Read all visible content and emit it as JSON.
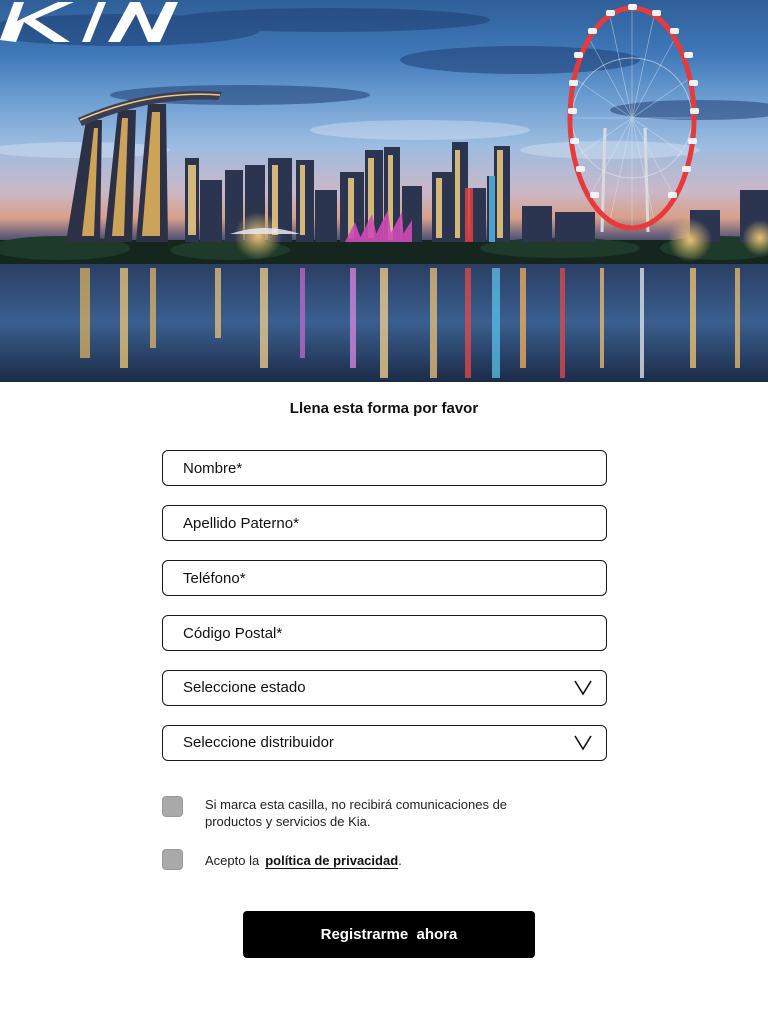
{
  "hero": {
    "image": "singapore-skyline-marina-bay-night",
    "logo_text": "KIA",
    "logo_icon": "kia-logo"
  },
  "form": {
    "title": "Llena esta forma por favor",
    "fields": {
      "nombre": {
        "placeholder": "Nombre*",
        "value": ""
      },
      "apellido": {
        "placeholder": "Apellido Paterno*",
        "value": ""
      },
      "telefono": {
        "placeholder": "Teléfono*",
        "value": ""
      },
      "codigo_postal": {
        "placeholder": "Código Postal*",
        "value": ""
      }
    },
    "selects": {
      "estado": {
        "selected": "Seleccione estado",
        "icon": "chevron-down-icon"
      },
      "distribuidor": {
        "selected": "Seleccione distribuidor",
        "icon": "chevron-down-icon"
      }
    },
    "checkboxes": {
      "no_comms": {
        "checked": false,
        "line1": "Si marca esta casilla, no recibirá comunicaciones de",
        "line2": "productos y servicios de Kia."
      },
      "privacy": {
        "checked": false,
        "prefix": "Acepto la",
        "link": "política de privacidad",
        "suffix": "."
      }
    },
    "submit_label": "Registrarme  ahora"
  }
}
